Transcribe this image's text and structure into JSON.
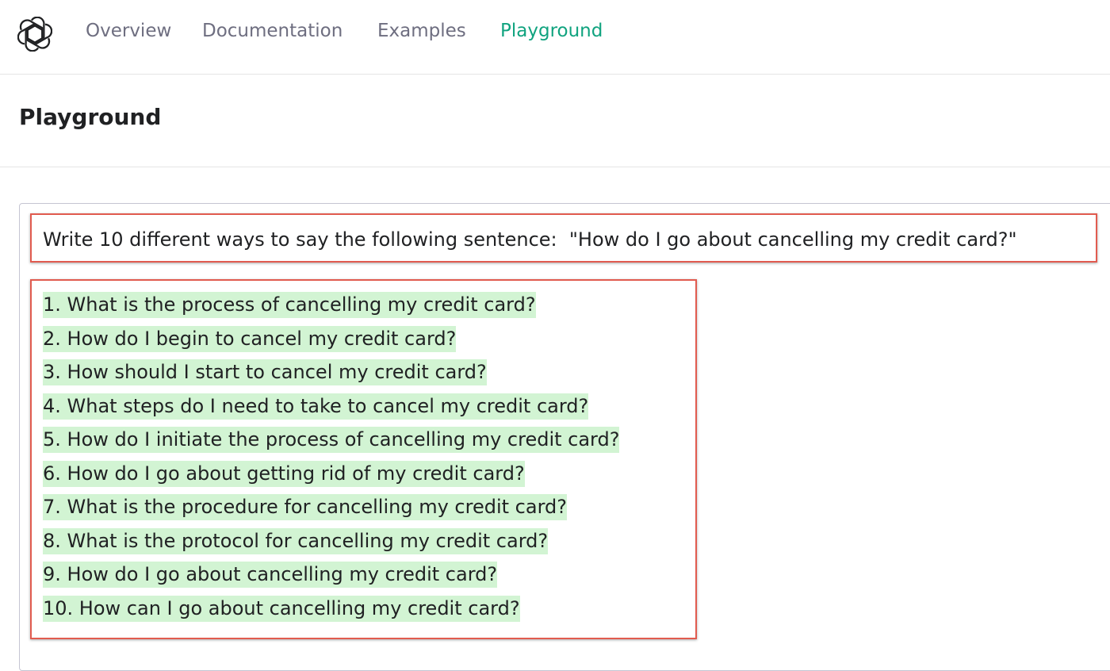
{
  "nav": {
    "items": [
      {
        "label": "Overview",
        "active": false
      },
      {
        "label": "Documentation",
        "active": false
      },
      {
        "label": "Examples",
        "active": false
      },
      {
        "label": "Playground",
        "active": true
      }
    ]
  },
  "page": {
    "title": "Playground"
  },
  "editor": {
    "prompt": "Write 10 different ways to say the following sentence:  \"How do I go about cancelling my credit card?\"",
    "completions": [
      "1. What is the process of cancelling my credit card?",
      "2. How do I begin to cancel my credit card?",
      "3. How should I start to cancel my credit card?",
      "4. What steps do I need to take to cancel my credit card?",
      "5. How do I initiate the process of cancelling my credit card?",
      "6. How do I go about getting rid of my credit card?",
      "7. What is the procedure for cancelling my credit card?",
      "8. What is the protocol for cancelling my credit card?",
      "9. How do I go about cancelling my credit card?",
      "10. How can I go about cancelling my credit card?"
    ]
  },
  "colors": {
    "accent": "#10a37f",
    "highlight": "#d2f4d3",
    "annotation": "#e15b4f"
  },
  "icons": {
    "logo": "openai-logo-icon"
  }
}
